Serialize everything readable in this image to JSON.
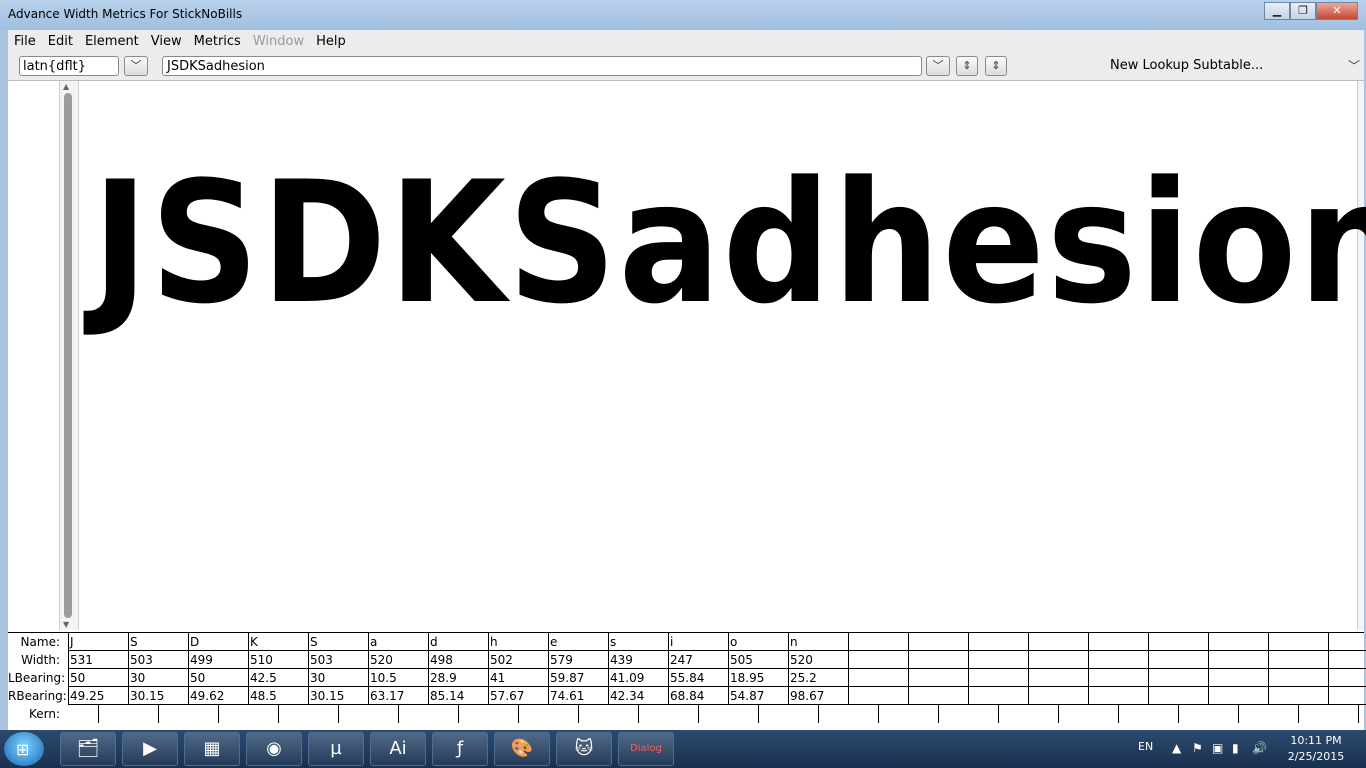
{
  "window": {
    "title": "Advance Width Metrics For StickNoBills",
    "minimize_label": "▁",
    "restore_label": "❐",
    "close_label": "✕"
  },
  "menu": {
    "items": [
      {
        "label": "File",
        "enabled": true
      },
      {
        "label": "Edit",
        "enabled": true
      },
      {
        "label": "Element",
        "enabled": true
      },
      {
        "label": "View",
        "enabled": true
      },
      {
        "label": "Metrics",
        "enabled": true
      },
      {
        "label": "Window",
        "enabled": false
      },
      {
        "label": "Help",
        "enabled": true
      }
    ]
  },
  "toolbar": {
    "script_value": "latn{dflt}",
    "text_value": "JSDKSadhesion",
    "lookup_label": "New Lookup Subtable..."
  },
  "canvas": {
    "glyph_text": "JSDKSadhesion"
  },
  "metrics": {
    "row_labels": {
      "name": "Name:",
      "width": "Width:",
      "lbearing": "LBearing:",
      "rbearing": "RBearing:",
      "kern": "Kern:"
    },
    "names": [
      "J",
      "S",
      "D",
      "K",
      "S",
      "a",
      "d",
      "h",
      "e",
      "s",
      "i",
      "o",
      "n"
    ],
    "widths": [
      "531",
      "503",
      "499",
      "510",
      "503",
      "520",
      "498",
      "502",
      "579",
      "439",
      "247",
      "505",
      "520"
    ],
    "lbearings": [
      "50",
      "30",
      "50",
      "42.5",
      "30",
      "10.5",
      "28.9",
      "41",
      "59.87",
      "41.09",
      "55.84",
      "18.95",
      "25.2"
    ],
    "rbearings": [
      "49.25",
      "30.15",
      "49.62",
      "48.5",
      "30.15",
      "63.17",
      "85.14",
      "57.67",
      "74.61",
      "42.34",
      "68.84",
      "54.87",
      "98.67"
    ]
  },
  "taskbar": {
    "apps": [
      {
        "name": "file-explorer",
        "glyph": "🗂"
      },
      {
        "name": "media-player",
        "glyph": "▶"
      },
      {
        "name": "app-grid",
        "glyph": "▦"
      },
      {
        "name": "chrome",
        "glyph": "◉"
      },
      {
        "name": "utorrent",
        "glyph": "µ"
      },
      {
        "name": "illustrator",
        "glyph": "Ai"
      },
      {
        "name": "fontforge",
        "glyph": "ƒ"
      },
      {
        "name": "paint",
        "glyph": "🎨"
      },
      {
        "name": "cat-app",
        "glyph": "🐱"
      },
      {
        "name": "dialog",
        "glyph": "Dialog"
      }
    ],
    "language": "EN",
    "time": "10:11 PM",
    "date": "2/25/2015"
  }
}
